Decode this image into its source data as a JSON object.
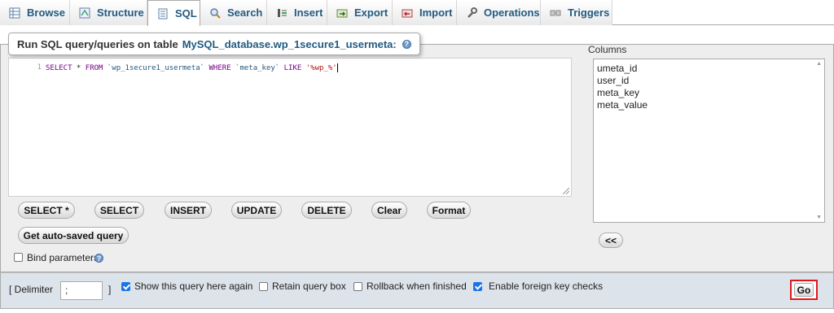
{
  "tabs": [
    {
      "label": "Browse",
      "icon": "browse-icon"
    },
    {
      "label": "Structure",
      "icon": "structure-icon"
    },
    {
      "label": "SQL",
      "icon": "sql-icon",
      "active": true
    },
    {
      "label": "Search",
      "icon": "search-icon"
    },
    {
      "label": "Insert",
      "icon": "insert-icon"
    },
    {
      "label": "Export",
      "icon": "export-icon"
    },
    {
      "label": "Import",
      "icon": "import-icon"
    },
    {
      "label": "Operations",
      "icon": "wrench-icon"
    },
    {
      "label": "Triggers",
      "icon": "triggers-icon"
    }
  ],
  "panel": {
    "legend_prefix": "Run SQL query/queries on table",
    "table_name": "MySQL_database.wp_1secure1_usermeta:",
    "help_icon": "?"
  },
  "editor": {
    "line_number": "1",
    "kw_select": "SELECT",
    "star": " * ",
    "kw_from": "FROM",
    "table": " `wp_1secure1_usermeta` ",
    "kw_where": "WHERE",
    "column": " `meta_key` ",
    "kw_like": "LIKE",
    "value": " '%wp_%'"
  },
  "buttons": {
    "select_star": "SELECT *",
    "select": "SELECT",
    "insert": "INSERT",
    "update": "UPDATE",
    "delete": "DELETE",
    "clear": "Clear",
    "format": "Format",
    "autosaved": "Get auto-saved query",
    "insert_columns": "<<",
    "go": "Go"
  },
  "bind_parameters": {
    "label": "Bind parameters",
    "checked": false
  },
  "columns": {
    "label": "Columns",
    "items": [
      "umeta_id",
      "user_id",
      "meta_key",
      "meta_value"
    ]
  },
  "bottom": {
    "delimiter_open": "[ Delimiter",
    "delimiter_value": ";",
    "delimiter_close": "]",
    "options": [
      {
        "label": "Show this query here again",
        "checked": true
      },
      {
        "label": "Retain query box",
        "checked": false
      },
      {
        "label": "Rollback when finished",
        "checked": false
      },
      {
        "label": "Enable foreign key checks",
        "checked": true
      }
    ]
  },
  "colors": {
    "link": "#235a81",
    "checkbox_on": "#1a73e8",
    "go_highlight": "#e0181b"
  }
}
